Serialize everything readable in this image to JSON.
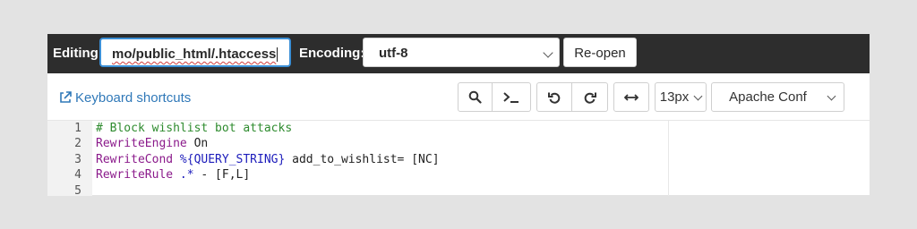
{
  "toolbar": {
    "editing_label": "Editing:",
    "file_path": "mo/public_html/.htaccess",
    "encoding_label": "Encoding:",
    "encoding_value": "utf-8",
    "reopen_label": "Re-open"
  },
  "editor_tools": {
    "keyboard_shortcuts": "Keyboard shortcuts",
    "font_size": "13px",
    "mode": "Apache Conf",
    "icons": [
      "search-icon",
      "terminal-icon",
      "undo-icon",
      "redo-icon",
      "wrap-icon"
    ]
  },
  "code": {
    "line_numbers": [
      "1",
      "2",
      "3",
      "4",
      "5"
    ],
    "line1": "# Block wishlist bot attacks",
    "line2_kw": "RewriteEngine",
    "line2_rest": " On",
    "line3_kw": "RewriteCond",
    "line3_var": " %{QUERY_STRING}",
    "line3_rest": " add_to_wishlist= [NC]",
    "line4_kw": "RewriteRule",
    "line4_var": " .*",
    "line4_rest": " - [F,L]",
    "line5": ""
  },
  "colors": {
    "comment": "#2e8b2e",
    "keyword": "#8b1a8b",
    "variable": "#1c1cbb",
    "link": "#2f78b8",
    "focus": "#3b8fd6"
  }
}
